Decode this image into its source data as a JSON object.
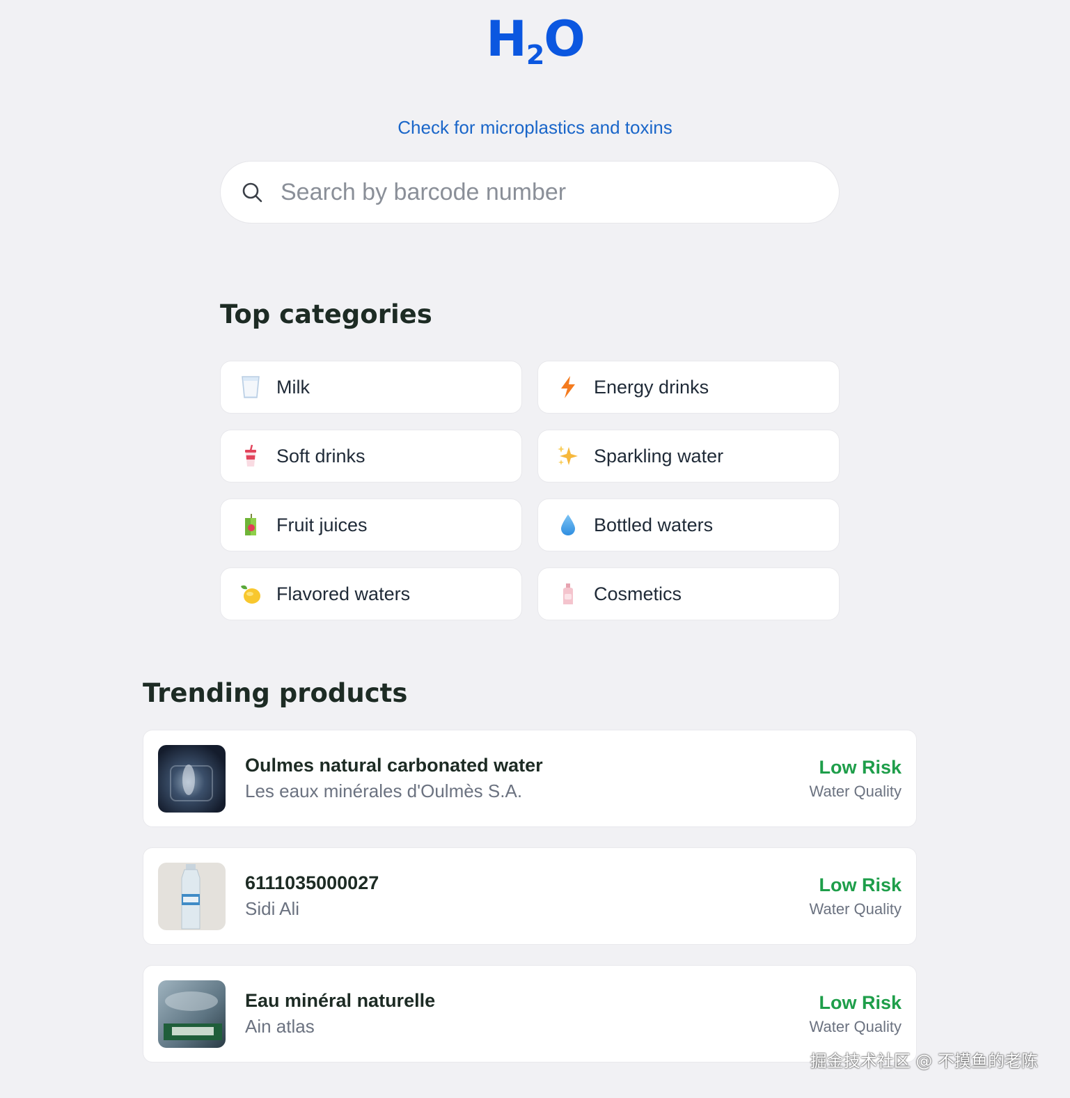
{
  "logo": {
    "part1": "H",
    "subscript": "2",
    "part2": "O"
  },
  "tagline": "Check for microplastics and toxins",
  "search": {
    "placeholder": "Search by barcode number",
    "value": ""
  },
  "categories_title": "Top categories",
  "categories": [
    {
      "label": "Milk",
      "icon": "milk-glass-icon"
    },
    {
      "label": "Energy drinks",
      "icon": "lightning-icon"
    },
    {
      "label": "Soft drinks",
      "icon": "cup-with-straw-icon"
    },
    {
      "label": "Sparkling water",
      "icon": "sparkles-icon"
    },
    {
      "label": "Fruit juices",
      "icon": "juice-box-icon"
    },
    {
      "label": "Bottled waters",
      "icon": "water-drop-icon"
    },
    {
      "label": "Flavored waters",
      "icon": "lemon-icon"
    },
    {
      "label": "Cosmetics",
      "icon": "lotion-bottle-icon"
    }
  ],
  "trending_title": "Trending products",
  "products": [
    {
      "name": "Oulmes natural carbonated water",
      "brand": "Les eaux minérales d'Oulmès S.A.",
      "risk": "Low Risk",
      "metric": "Water Quality"
    },
    {
      "name": "6111035000027",
      "brand": "Sidi Ali",
      "risk": "Low Risk",
      "metric": "Water Quality"
    },
    {
      "name": "Eau minéral naturelle",
      "brand": "Ain atlas",
      "risk": "Low Risk",
      "metric": "Water Quality"
    }
  ],
  "watermark": "掘金技术社区 @ 不摸鱼的老陈",
  "colors": {
    "brand": "#0b57e0",
    "link": "#1a66c9",
    "low_risk": "#1e9e4a",
    "background": "#f1f1f4"
  }
}
